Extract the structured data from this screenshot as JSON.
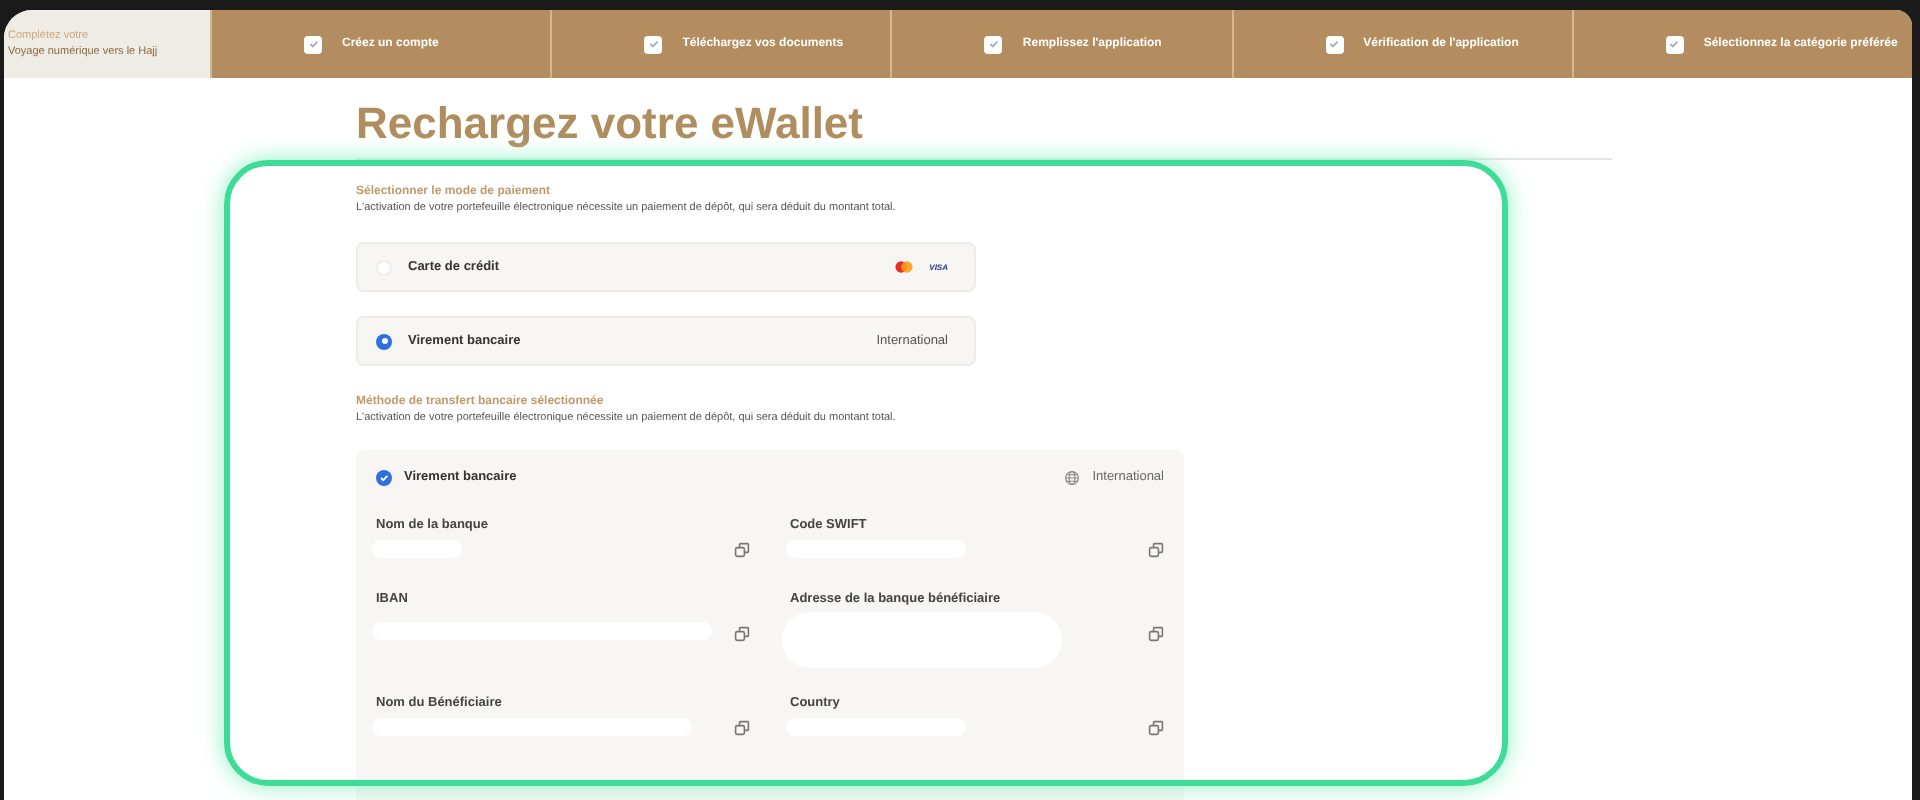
{
  "intro": {
    "line_1": "Complétez votre",
    "line_2": "Voyage numérique vers le Hajj"
  },
  "steps": [
    {
      "label": "Créez un compte",
      "checked": true
    },
    {
      "label": "Téléchargez vos documents",
      "checked": true
    },
    {
      "label": "Remplissez l'application",
      "checked": true
    },
    {
      "label": "Vérification de l'application",
      "checked": true
    },
    {
      "label": "Sélectionnez la catégorie préférée",
      "checked": true
    }
  ],
  "title": "Rechargez votre eWallet",
  "payment_section": {
    "heading": "Sélectionner le mode de paiement",
    "description": "L'activation de votre portefeuille électronique nécessite un paiement de dépôt, qui sera déduit du montant total.",
    "options": [
      {
        "kind": "cards",
        "label": "Carte de crédit",
        "selected": false,
        "card_brand": "VISA"
      },
      {
        "kind": "tag",
        "label": "Virement bancaire",
        "selected": true,
        "tag": "International"
      }
    ]
  },
  "transfer_section": {
    "heading": "Méthode de transfert bancaire sélectionnée",
    "description": "L'activation de votre portefeuille électronique nécessite un paiement de dépôt, qui sera déduit du montant total.",
    "method": {
      "label": "Virement bancaire",
      "checked": true,
      "region": "International"
    },
    "fields": [
      {
        "label": "Nom de la banque",
        "redacted": true
      },
      {
        "label": "Code SWIFT",
        "redacted": true
      },
      {
        "label": "IBAN",
        "redacted": true
      },
      {
        "label": "Adresse de la banque bénéficiaire",
        "redacted": true
      },
      {
        "label": "Nom du Bénéficiaire",
        "redacted": true
      },
      {
        "label": "Country",
        "redacted": true
      }
    ]
  }
}
